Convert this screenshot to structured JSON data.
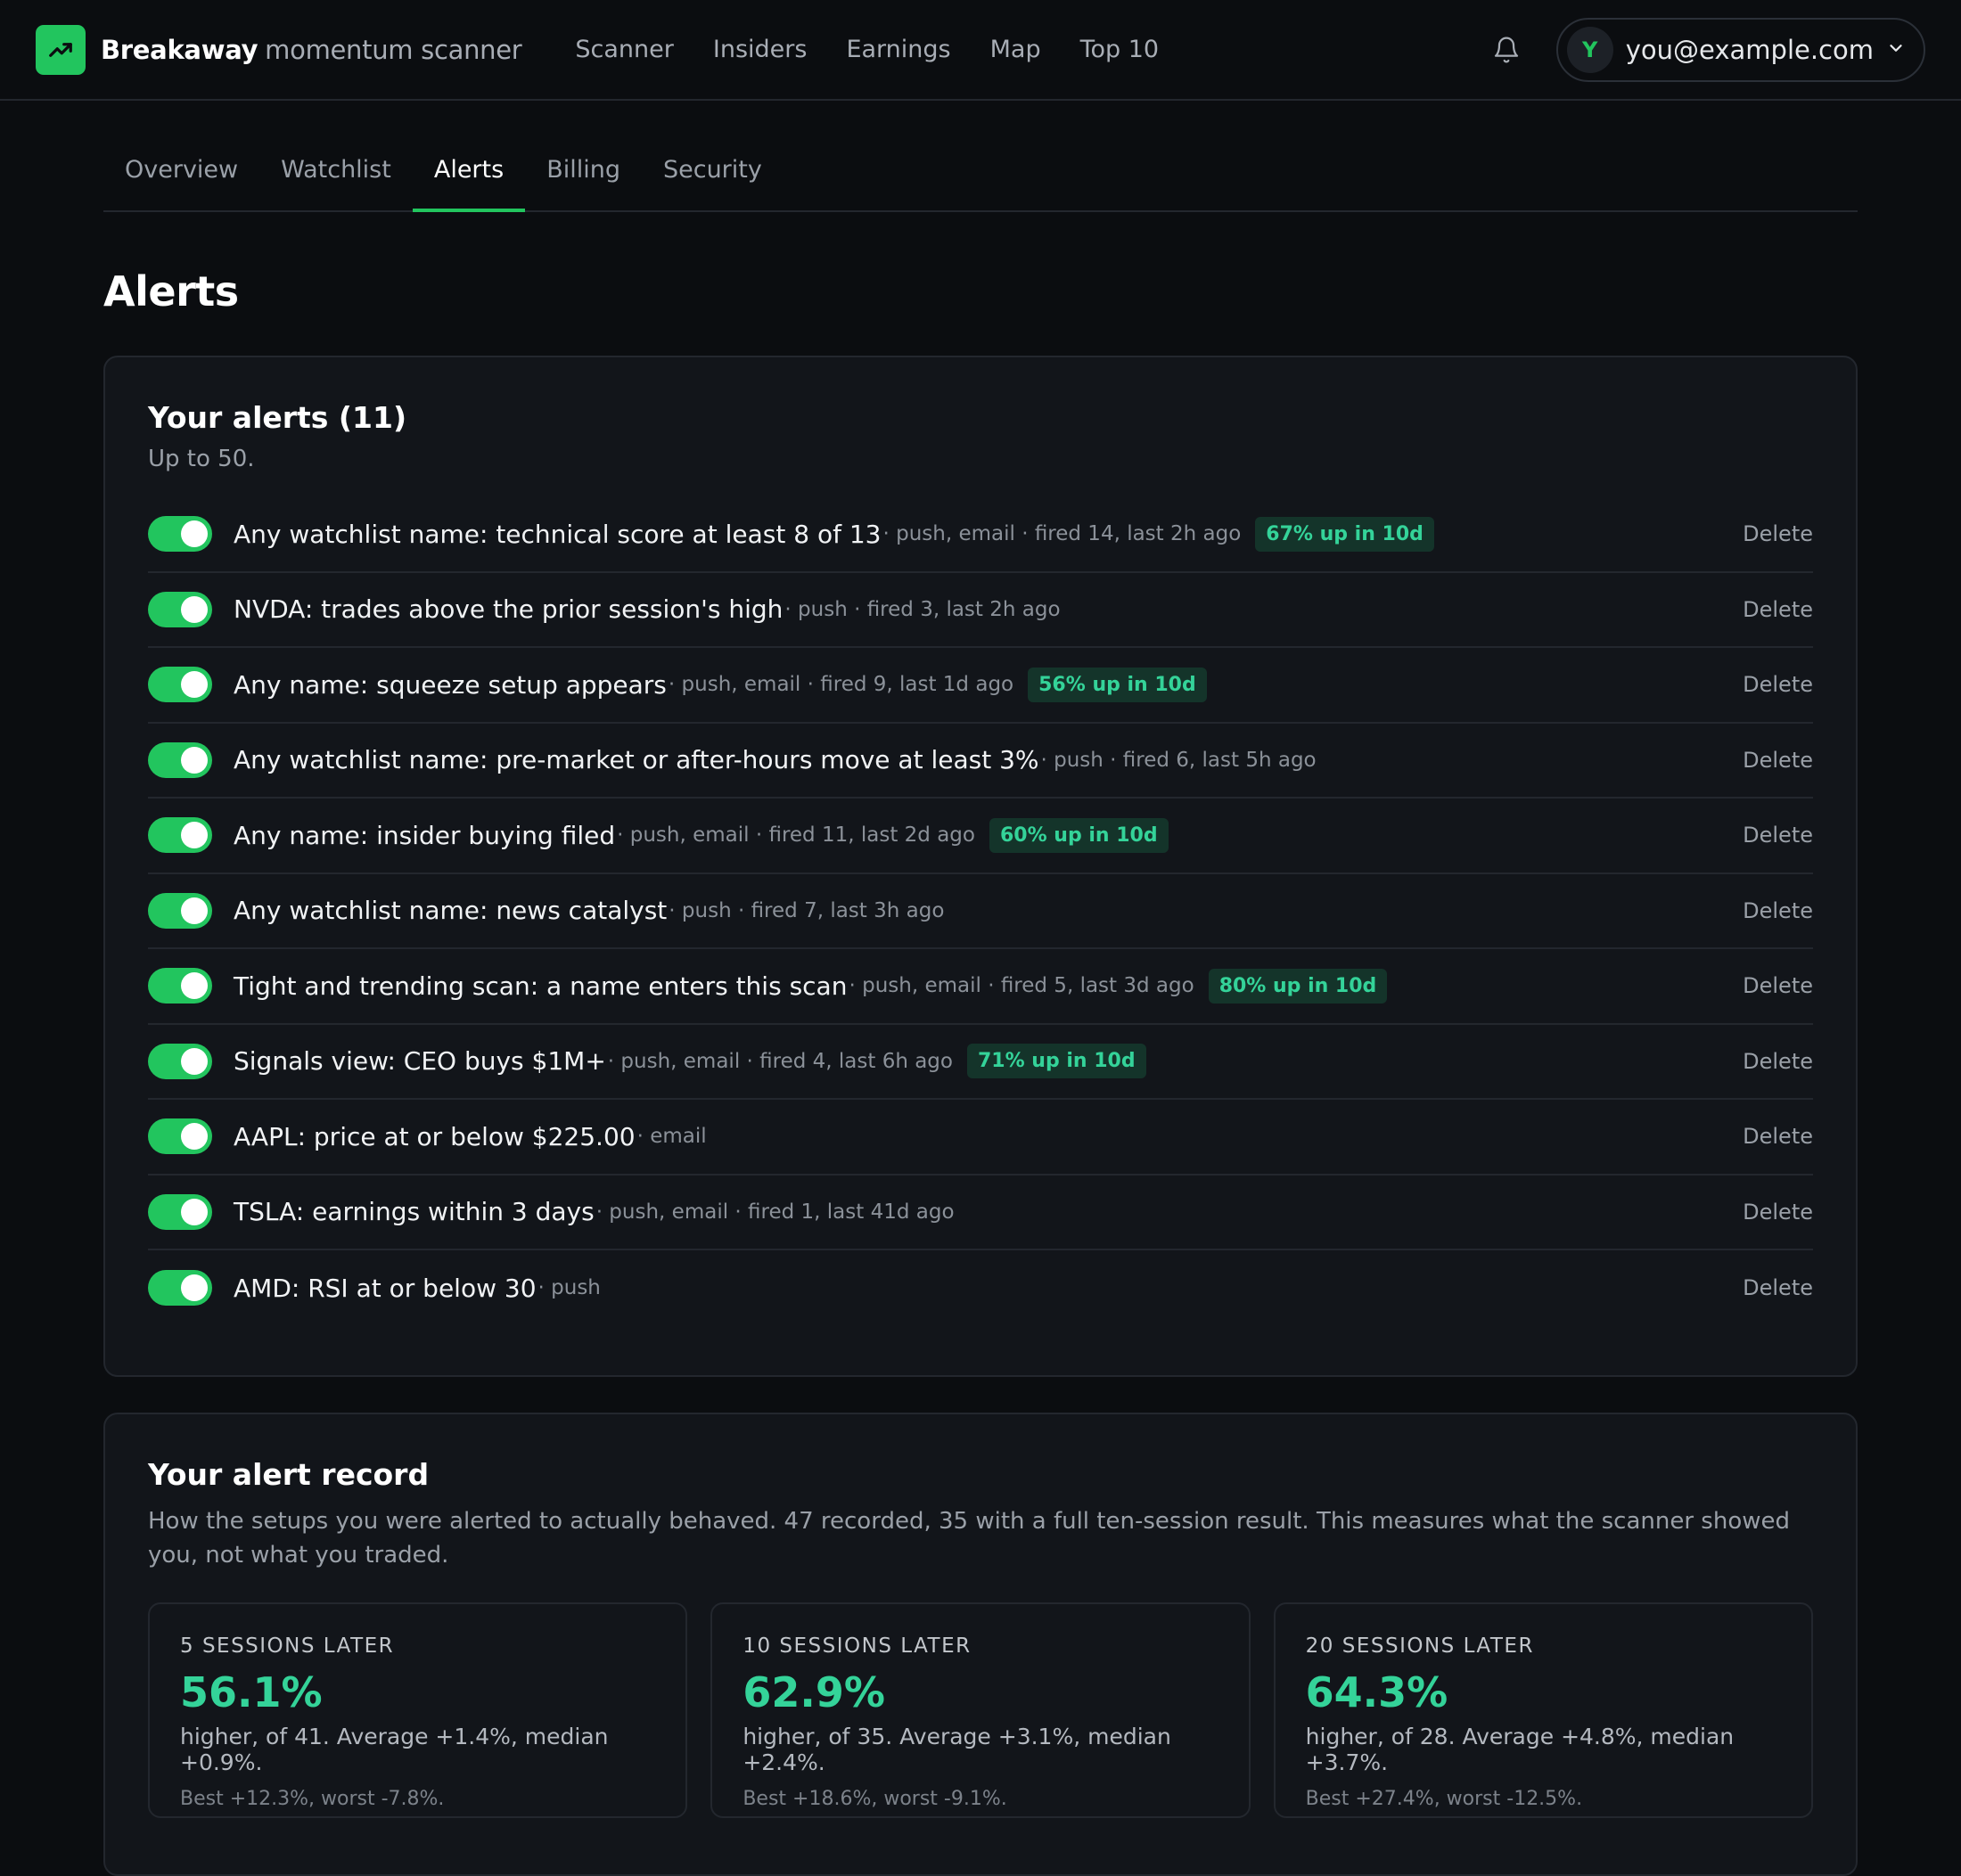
{
  "header": {
    "brand_bold": "Breakaway",
    "brand_rest": "momentum scanner",
    "nav": [
      "Scanner",
      "Insiders",
      "Earnings",
      "Map",
      "Top 10"
    ],
    "account_initial": "Y",
    "account_email": "you@example.com",
    "accent": "#22c55e"
  },
  "tabs": [
    "Overview",
    "Watchlist",
    "Alerts",
    "Billing",
    "Security"
  ],
  "active_tab": "Alerts",
  "page_title": "Alerts",
  "alerts": {
    "title": "Your alerts (11)",
    "subtitle": "Up to 50.",
    "delete_label": "Delete",
    "items": [
      {
        "text": "Any watchlist name: technical score at least 8 of 13",
        "meta": "· push, email · fired 14, last 2h ago",
        "badge": "67% up in 10d",
        "enabled": true
      },
      {
        "text": "NVDA: trades above the prior session's high",
        "meta": "· push · fired 3, last 2h ago",
        "badge": "",
        "enabled": true
      },
      {
        "text": "Any name: squeeze setup appears",
        "meta": "· push, email · fired 9, last 1d ago",
        "badge": "56% up in 10d",
        "enabled": true
      },
      {
        "text": "Any watchlist name: pre-market or after-hours move at least 3%",
        "meta": "· push · fired 6, last 5h ago",
        "badge": "",
        "enabled": true
      },
      {
        "text": "Any name: insider buying filed",
        "meta": "· push, email · fired 11, last 2d ago",
        "badge": "60% up in 10d",
        "enabled": true
      },
      {
        "text": "Any watchlist name: news catalyst",
        "meta": "· push · fired 7, last 3h ago",
        "badge": "",
        "enabled": true
      },
      {
        "text": "Tight and trending scan: a name enters this scan",
        "meta": "· push, email · fired 5, last 3d ago",
        "badge": "80% up in 10d",
        "enabled": true
      },
      {
        "text": "Signals view: CEO buys $1M+",
        "meta": "· push, email · fired 4, last 6h ago",
        "badge": "71% up in 10d",
        "enabled": true
      },
      {
        "text": "AAPL: price at or below $225.00",
        "meta": "· email",
        "badge": "",
        "enabled": true
      },
      {
        "text": "TSLA: earnings within 3 days",
        "meta": "· push, email · fired 1, last 41d ago",
        "badge": "",
        "enabled": true
      },
      {
        "text": "AMD: RSI at or below 30",
        "meta": "· push",
        "badge": "",
        "enabled": true
      }
    ]
  },
  "record": {
    "title": "Your alert record",
    "description": "How the setups you were alerted to actually behaved. 47 recorded, 35 with a full ten-session result. This measures what the scanner showed you, not what you traded.",
    "stats": [
      {
        "label": "5 SESSIONS LATER",
        "value": "56.1%",
        "desc": "higher, of 41. Average +1.4%, median +0.9%.",
        "extra": "Best +12.3%, worst -7.8%."
      },
      {
        "label": "10 SESSIONS LATER",
        "value": "62.9%",
        "desc": "higher, of 35. Average +3.1%, median +2.4%.",
        "extra": "Best +18.6%, worst -9.1%."
      },
      {
        "label": "20 SESSIONS LATER",
        "value": "64.3%",
        "desc": "higher, of 28. Average +4.8%, median +3.7%.",
        "extra": "Best +27.4%, worst -12.5%."
      }
    ]
  }
}
